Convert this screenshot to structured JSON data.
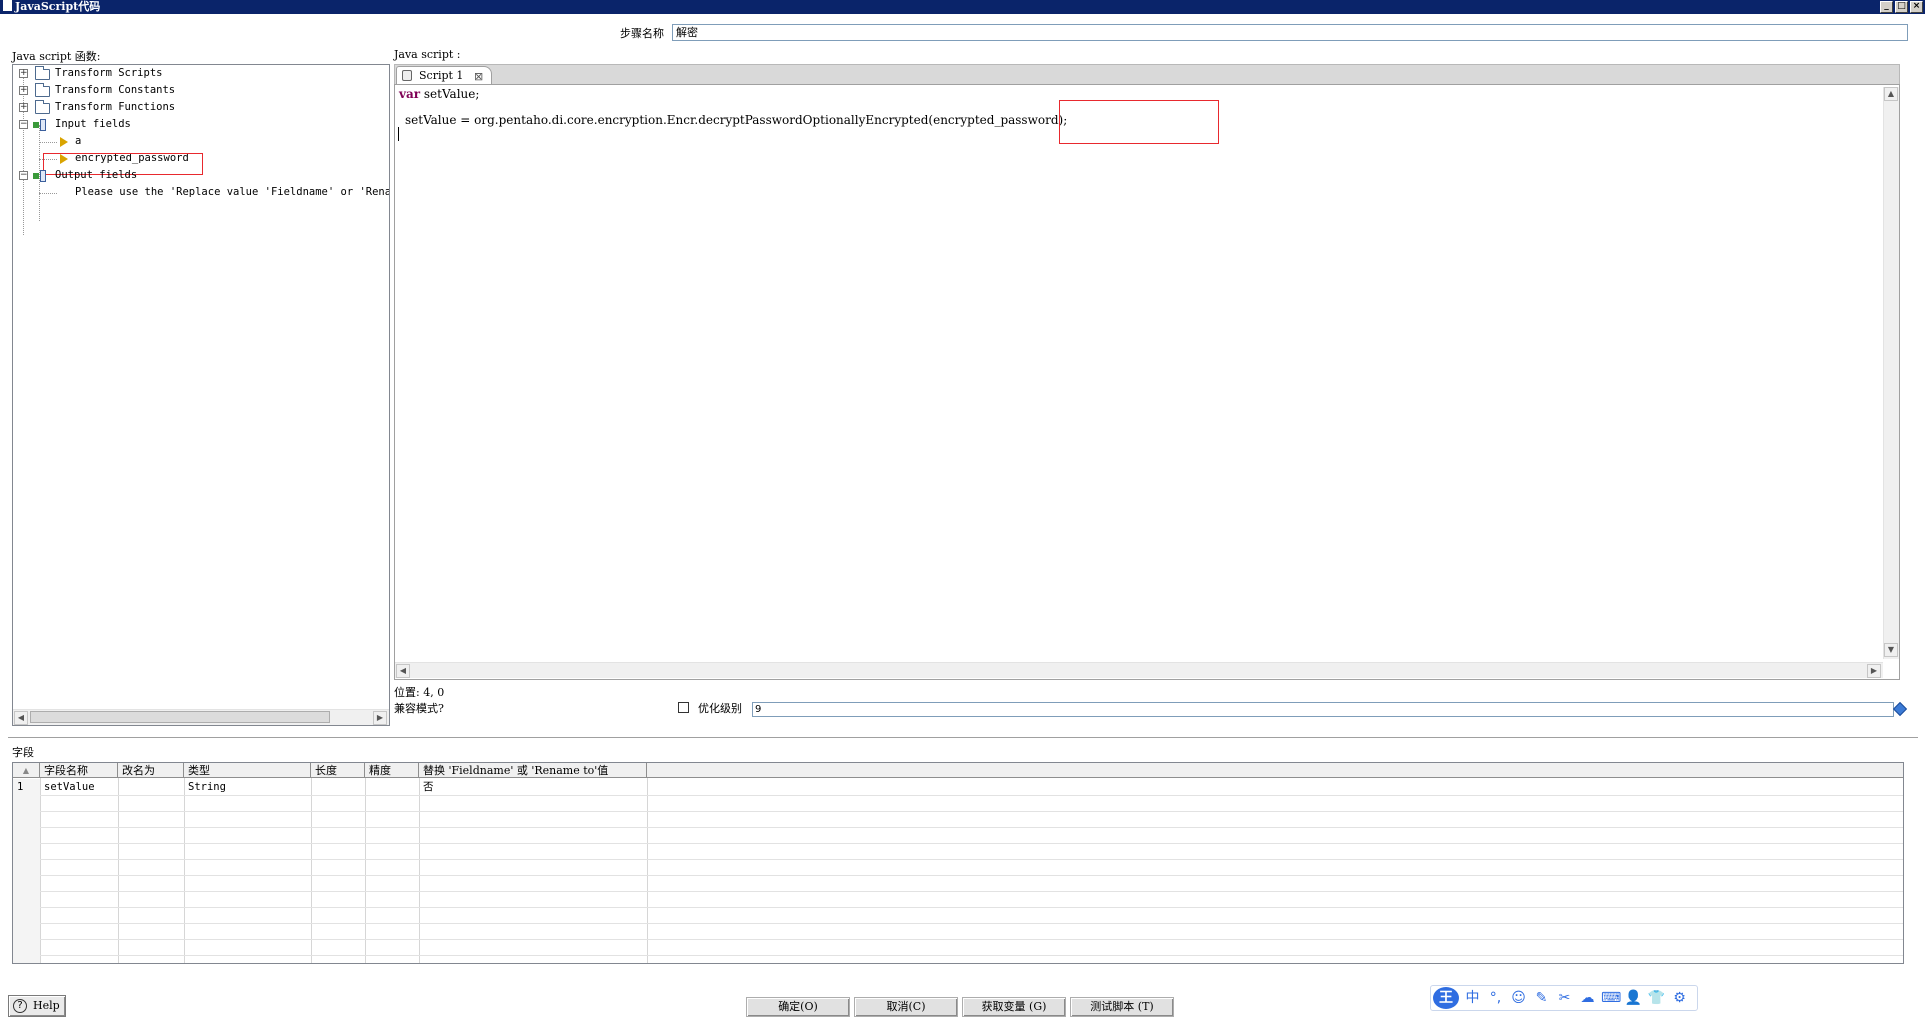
{
  "window": {
    "title": "JavaScript代码",
    "buttons": [
      "_",
      "□",
      "×"
    ]
  },
  "step": {
    "label": "步骤名称",
    "value": "解密"
  },
  "functions_panel": {
    "label": "Java script 函数:",
    "items": [
      {
        "label": "Transform Scripts",
        "icon": "folder-icon"
      },
      {
        "label": "Transform Constants",
        "icon": "folder-icon"
      },
      {
        "label": "Transform Functions",
        "icon": "folder-icon"
      },
      {
        "label": "Input fields",
        "icon": "input-fields-icon"
      },
      {
        "label": "a",
        "icon": "field-arrow-icon"
      },
      {
        "label": "encrypted_password",
        "icon": "field-arrow-icon"
      },
      {
        "label": "Output fields",
        "icon": "output-fields-icon"
      },
      {
        "label": "Please use the 'Replace value 'Fieldname' or 'Rename",
        "icon": ""
      }
    ]
  },
  "editor": {
    "label": "Java script :",
    "tab_label": "Script 1",
    "code_line1_kw": "var",
    "code_line1_rest": " setValue;",
    "code_line2_prefix": "setValue = org.pentaho.di.core.encryption.Encr.decryptPasswordOptionallyEncrypted",
    "code_line2_arg": "(encrypted_password)",
    "code_line2_suffix": ";"
  },
  "status": {
    "position": "位置: 4, 0",
    "compat_label": "兼容模式?",
    "optimize_label": "优化级别",
    "optimize_value": "9"
  },
  "fields": {
    "label": "字段",
    "columns": [
      "字段名称",
      "改名为",
      "类型",
      "长度",
      "精度",
      "替换 'Fieldname' 或 'Rename to'值"
    ],
    "rows": [
      {
        "num": "1",
        "name": "setValue",
        "rename": "",
        "type": "String",
        "length": "",
        "precision": "",
        "replace": "否"
      }
    ]
  },
  "buttons": {
    "help": "Help",
    "ok": "确定(O)",
    "cancel": "取消(C)",
    "get_vars": "获取变量 (G)",
    "test": "测试脚本 (T)"
  },
  "ime": {
    "logo": "王",
    "items": [
      "中",
      "°,",
      "☺",
      "✎",
      "✂",
      "☁",
      "⌨",
      "👤",
      "👕",
      "⚙"
    ]
  }
}
